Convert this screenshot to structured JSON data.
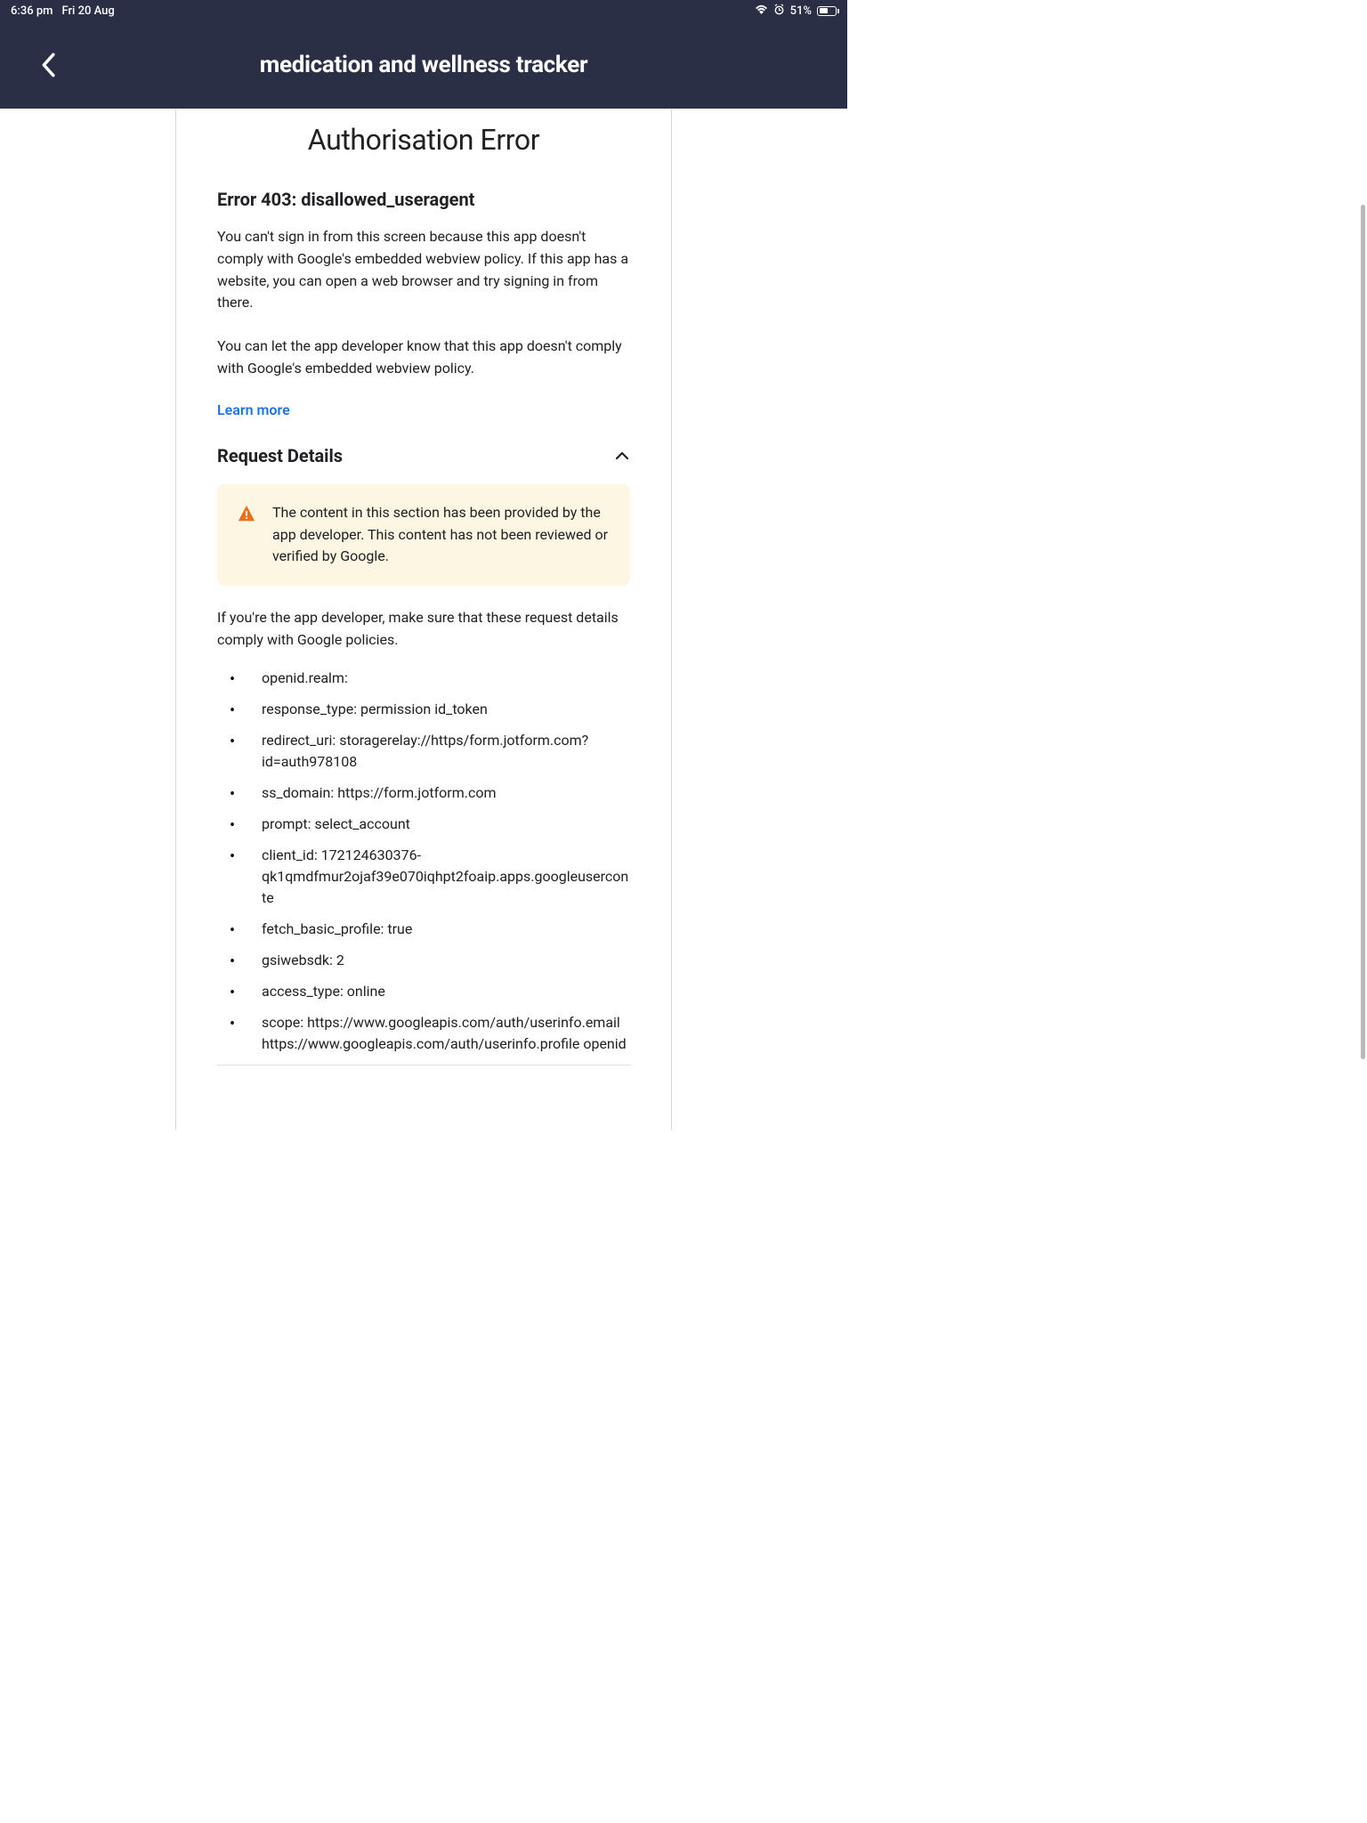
{
  "status": {
    "time": "6:36 pm",
    "date": "Fri 20 Aug",
    "battery_pct": "51%"
  },
  "nav": {
    "title": "medication and wellness tracker"
  },
  "page": {
    "heading": "Authorisation Error",
    "error_title": "Error 403: disallowed_useragent",
    "para1": "You can't sign in from this screen because this app doesn't comply with Google's embedded webview policy. If this app has a website, you can open a web browser and try signing in from there.",
    "para2": "You can let the app developer know that this app doesn't comply with Google's embedded webview policy.",
    "learn_more": "Learn more",
    "request_details_label": "Request Details",
    "warning_text": "The content in this section has been provided by the app developer. This content has not been reviewed or verified by Google.",
    "dev_note": "If you're the app developer, make sure that these request details comply with Google policies.",
    "details": [
      "openid.realm:",
      "response_type: permission id_token",
      "redirect_uri: storagerelay://https/form.jotform.com?id=auth978108",
      "ss_domain: https://form.jotform.com",
      "prompt: select_account",
      "client_id: 172124630376-qk1qmdfmur2ojaf39e070iqhpt2foaip.apps.googleuserconte",
      "fetch_basic_profile: true",
      "gsiwebsdk: 2",
      "access_type: online",
      "scope: https://www.googleapis.com/auth/userinfo.email https://www.googleapis.com/auth/userinfo.profile openid"
    ]
  }
}
